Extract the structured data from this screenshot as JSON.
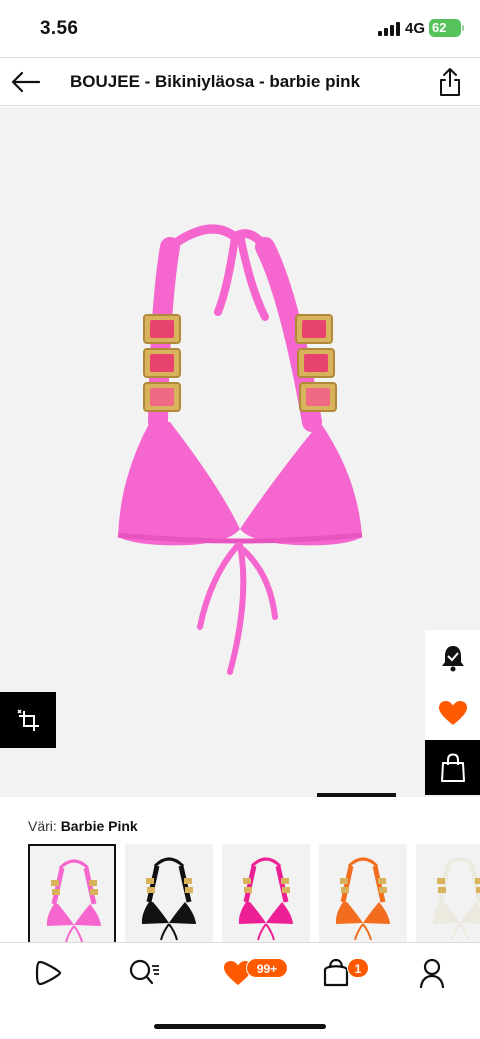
{
  "status_bar": {
    "time": "3.56",
    "network": "4G",
    "battery": "62"
  },
  "nav": {
    "title": "BOUJEE - Bikiniyläosa - barbie pink"
  },
  "product": {
    "color_label": "Väri:",
    "color_value": "Barbie Pink",
    "swatches": [
      {
        "name": "Barbie Pink",
        "color": "#f566cf",
        "selected": true
      },
      {
        "name": "Black",
        "color": "#111111",
        "selected": false
      },
      {
        "name": "Hot Pink",
        "color": "#ec1f95",
        "selected": false
      },
      {
        "name": "Orange",
        "color": "#f36d1f",
        "selected": false
      },
      {
        "name": "Cream",
        "color": "#ece9de",
        "selected": false
      }
    ]
  },
  "tab_bar": {
    "items": [
      {
        "name": "Home",
        "icon": "play-icon"
      },
      {
        "name": "Search",
        "icon": "search-icon"
      },
      {
        "name": "Wishlist",
        "icon": "heart-icon",
        "badge": "99+"
      },
      {
        "name": "Bag",
        "icon": "bag-icon",
        "badge": "1"
      },
      {
        "name": "Account",
        "icon": "profile-icon"
      }
    ]
  },
  "colors": {
    "accent": "#ff5a00",
    "product_pink": "#f566cf",
    "hero_bg": "#f2f2f2"
  }
}
